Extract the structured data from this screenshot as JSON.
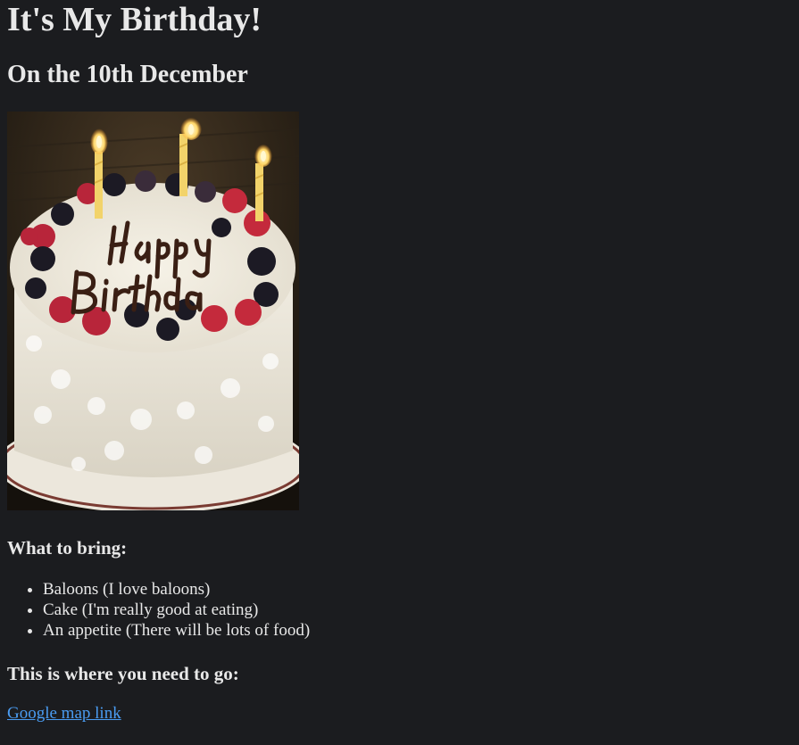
{
  "heading": "It's My Birthday!",
  "subheading": "On the 10th December",
  "image": {
    "description_icon": "birthday-cake-photo",
    "lettering": "Happy Birthday"
  },
  "bring": {
    "title": "What to bring:",
    "items": [
      "Baloons (I love baloons)",
      "Cake (I'm really good at eating)",
      "An appetite (There will be lots of food)"
    ]
  },
  "directions": {
    "title": "This is where you need to go:",
    "link_text": "Google map link"
  },
  "colors": {
    "background": "#1b1c1f",
    "text": "#e8e8e8",
    "link": "#4a9cf2"
  }
}
